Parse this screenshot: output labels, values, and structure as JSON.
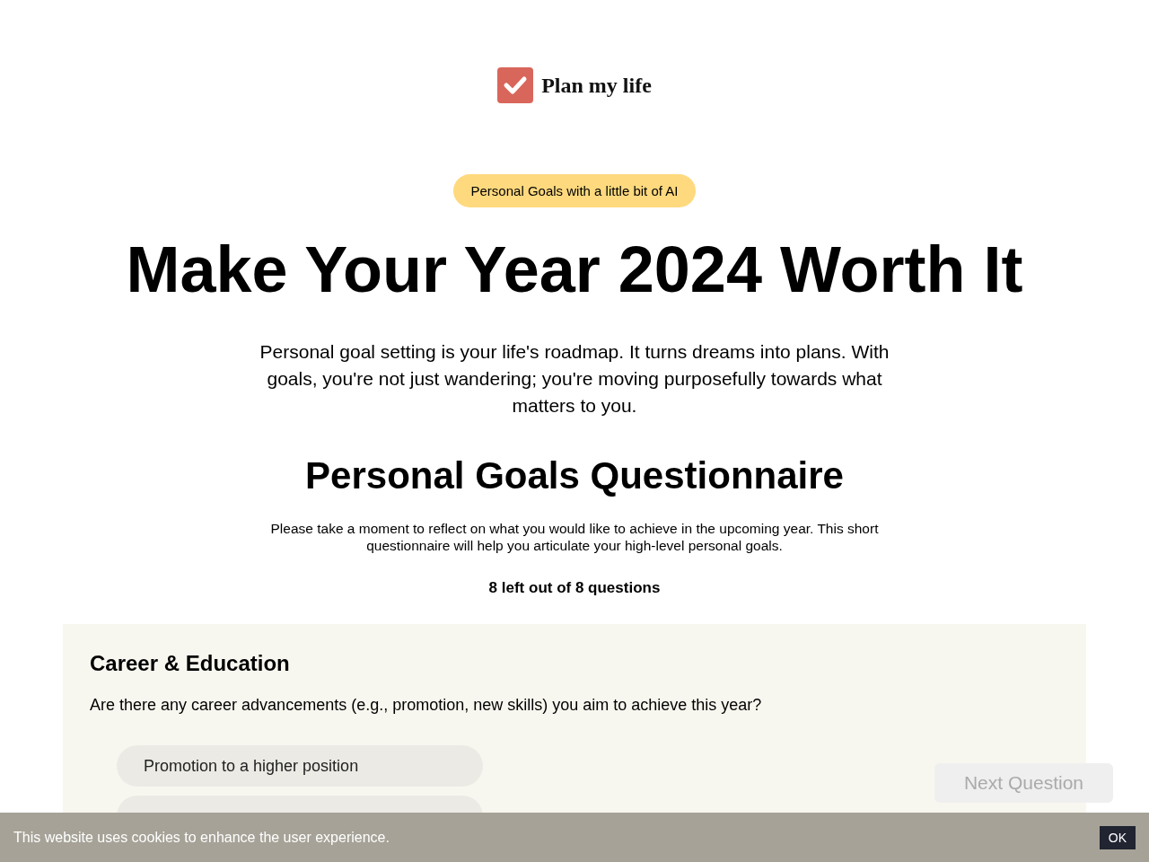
{
  "logo": {
    "text": "Plan my life"
  },
  "badge": "Personal Goals with a little bit of AI",
  "headline": "Make Your Year 2024 Worth It",
  "intro": "Personal goal setting is your life's roadmap. It turns dreams into plans. With goals, you're not just wandering; you're moving purposefully towards what matters to you.",
  "questionnaire": {
    "title": "Personal Goals Questionnaire",
    "description": "Please take a moment to reflect on what you would like to achieve in the upcoming year. This short questionnaire will help you articulate your high-level personal goals.",
    "progress": "8 left out of 8 questions"
  },
  "question": {
    "category": "Career & Education",
    "text": "Are there any career advancements (e.g., promotion, new skills) you aim to achieve this year?",
    "options": [
      {
        "label": "Promotion to a higher position",
        "selected": false
      },
      {
        "selected": false
      }
    ]
  },
  "next_button": {
    "label": "Next Question",
    "disabled": true
  },
  "cookie_bar": {
    "text": "This website uses cookies to enhance the user experience.",
    "button": "OK"
  }
}
